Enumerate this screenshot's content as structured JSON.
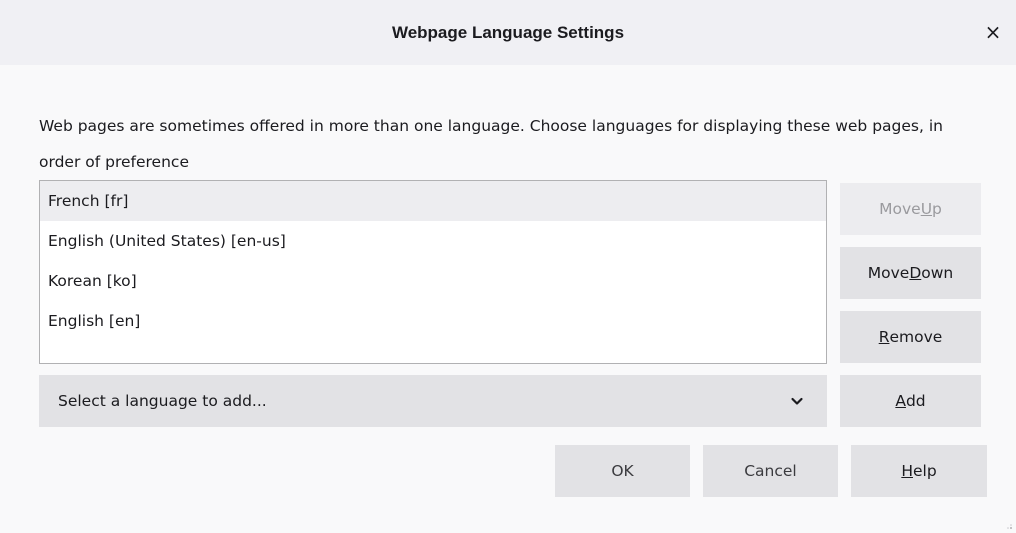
{
  "dialog": {
    "title": "Webpage Language Settings",
    "close_label": "×"
  },
  "description": "Web pages are sometimes offered in more than one language. Choose languages for displaying these web pages, in order of preference",
  "languages": [
    {
      "label": "French [fr]",
      "selected": true
    },
    {
      "label": "English (United States) [en-us]",
      "selected": false
    },
    {
      "label": "Korean [ko]",
      "selected": false
    },
    {
      "label": "English [en]",
      "selected": false
    }
  ],
  "side_buttons": {
    "move_up": {
      "label": "Move Up",
      "access_key": "U",
      "enabled": false
    },
    "move_down": {
      "label": "Move Down",
      "access_key": "D",
      "enabled": true
    },
    "remove": {
      "label": "Remove",
      "access_key": "R",
      "enabled": true
    },
    "add": {
      "label": "Add",
      "access_key": "A",
      "enabled": true
    }
  },
  "select": {
    "placeholder": "Select a language to add...",
    "icon": "chevron-down-icon"
  },
  "footer": {
    "ok": "OK",
    "cancel": "Cancel",
    "help": "Help",
    "help_access_key": "H"
  }
}
